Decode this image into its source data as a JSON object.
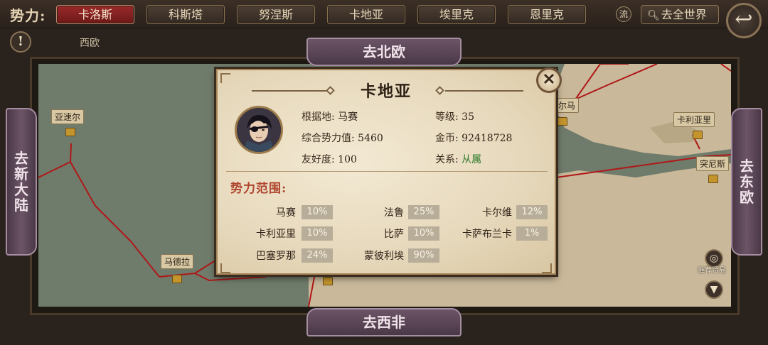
{
  "topbar": {
    "faction_label": "势力:",
    "tabs": [
      {
        "label": "卡洛斯",
        "active": true
      },
      {
        "label": "科斯塔",
        "active": false
      },
      {
        "label": "努涅斯",
        "active": false
      },
      {
        "label": "卡地亚",
        "active": false
      },
      {
        "label": "埃里克",
        "active": false
      },
      {
        "label": "恩里克",
        "active": false
      }
    ],
    "liu_label": "流",
    "world_button": "去全世界",
    "back_icon": "back-arrow-icon"
  },
  "region": "西欧",
  "alert_label": "!",
  "directions": {
    "north": "去北欧",
    "south": "去西非",
    "west": "去新大陆",
    "east": "去东欧"
  },
  "map": {
    "cities": [
      {
        "name": "亚速尔"
      },
      {
        "name": "马德拉"
      },
      {
        "name": "卡利亚里"
      },
      {
        "name": "突尼斯"
      },
      {
        "name": "尔马"
      }
    ],
    "trade_label": "推荐贸易",
    "down_button": "▼",
    "route_color": "#b01818"
  },
  "dialog": {
    "title": "卡地亚",
    "close_label": "✕",
    "base_label": "根据地:",
    "base_value": "马赛",
    "level_label": "等级:",
    "level_value": "35",
    "power_label": "综合势力值:",
    "power_value": "5460",
    "gold_label": "金币:",
    "gold_value": "92418728",
    "friendship_label": "友好度:",
    "friendship_value": "100",
    "relation_label": "关系:",
    "relation_value": "从属",
    "scope_title": "势力范围:",
    "scope": [
      {
        "name": "马赛",
        "value": "10%"
      },
      {
        "name": "法鲁",
        "value": "25%"
      },
      {
        "name": "卡尔维",
        "value": "12%"
      },
      {
        "name": "卡利亚里",
        "value": "10%"
      },
      {
        "name": "比萨",
        "value": "10%"
      },
      {
        "name": "卡萨布兰卡",
        "value": "1%"
      },
      {
        "name": "巴塞罗那",
        "value": "24%"
      },
      {
        "name": "蒙彼利埃",
        "value": "90%"
      }
    ]
  },
  "colors": {
    "accent_red": "#9a2a2a",
    "relation_green": "#2f7a2a",
    "scope_title": "#b0452e"
  }
}
